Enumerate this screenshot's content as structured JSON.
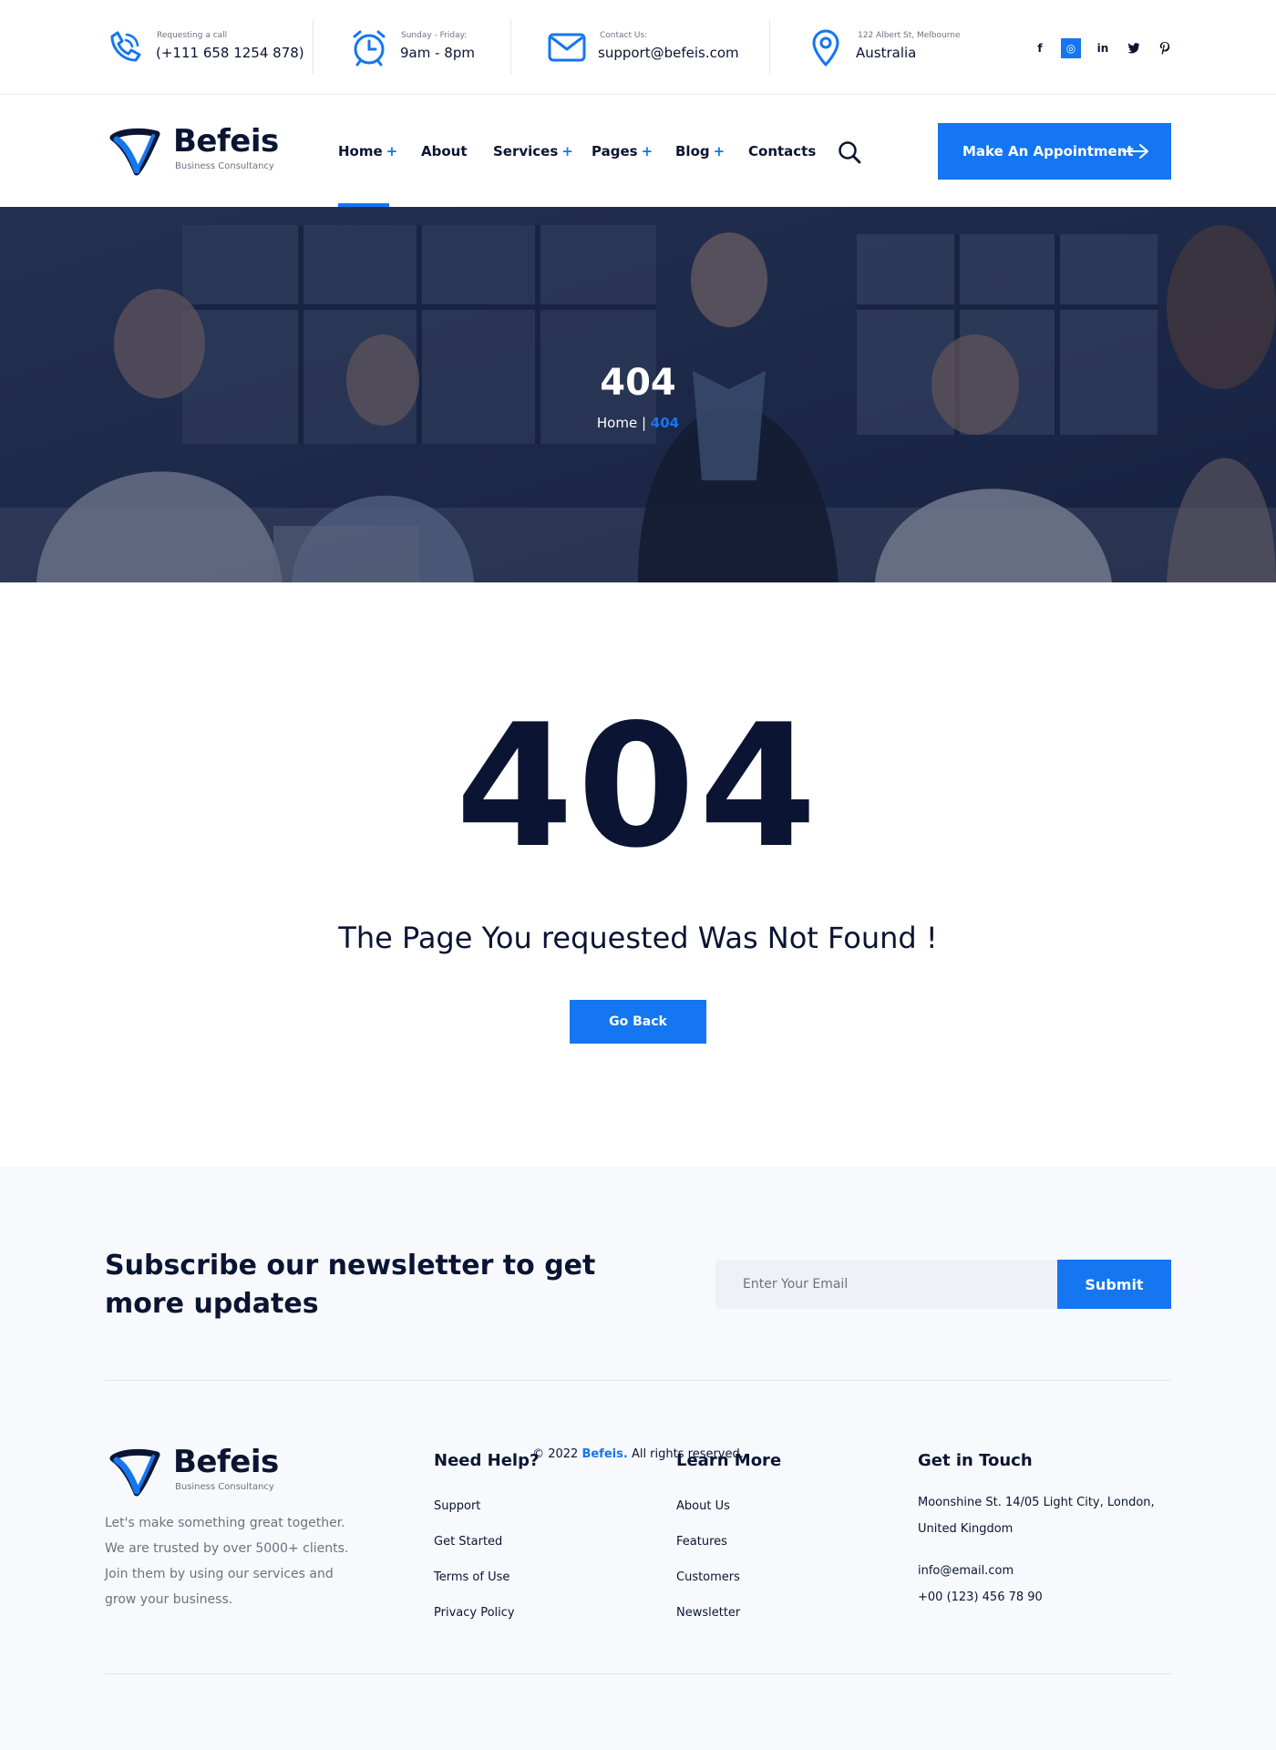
{
  "topbar": {
    "call": {
      "label": "Requesting a call",
      "value": "(+111 658 1254 878)",
      "icon": "phone-icon"
    },
    "hours": {
      "label": "Sunday - Friday:",
      "value": "9am - 8pm",
      "icon": "alarm-clock-icon"
    },
    "email": {
      "label": "Contact Us:",
      "value": "support@befeis.com",
      "icon": "envelope-icon"
    },
    "location": {
      "label": "122 Albert St, Melbourne",
      "value": "Australia",
      "icon": "map-pin-icon"
    },
    "socials": [
      {
        "name": "facebook-icon",
        "glyph": "f"
      },
      {
        "name": "dribbble-icon",
        "glyph": "◎"
      },
      {
        "name": "linkedin-icon",
        "glyph": "in"
      },
      {
        "name": "twitter-icon",
        "glyph": "🐦"
      },
      {
        "name": "pinterest-icon",
        "glyph": "P"
      }
    ]
  },
  "brand": {
    "name": "Befeis",
    "tagline": "Business Consultancy",
    "accent": "#1476f1",
    "dark": "#0b1533"
  },
  "nav": {
    "items": [
      {
        "label": "Home",
        "plus": "+"
      },
      {
        "label": "About",
        "plus": ""
      },
      {
        "label": "Services",
        "plus": "+"
      },
      {
        "label": "Pages",
        "plus": "+"
      },
      {
        "label": "Blog",
        "plus": "+"
      },
      {
        "label": "Contacts",
        "plus": ""
      }
    ],
    "active": "Home",
    "cta": "Make An Appointment"
  },
  "hero": {
    "title": "404",
    "breadcrumb_home": "Home",
    "breadcrumb_sep": "|",
    "breadcrumb_current": "404"
  },
  "error": {
    "code": "404",
    "message": "The Page You requested Was Not Found !",
    "button": "Go Back"
  },
  "newsletter": {
    "title": "Subscribe our newsletter to get more updates",
    "placeholder": "Enter Your Email",
    "button": "Submit"
  },
  "footer": {
    "about": "Let's make something great together. We are trusted by over 5000+ clients. Join them by using our services and grow your business.",
    "help": {
      "title": "Need Help?",
      "links": [
        "Support",
        "Get Started",
        "Terms of Use",
        "Privacy Policy"
      ]
    },
    "learn": {
      "title": "Learn More",
      "links": [
        "About Us",
        "Features",
        "Customers",
        "Newsletter"
      ]
    },
    "contact": {
      "title": "Get in Touch",
      "address_line1": "Moonshine St. 14/05 Light City, London,",
      "address_line2": "United Kingdom",
      "email": "info@email.com",
      "phone": "+00 (123) 456 78 90"
    },
    "copyright_pre": "© 2022",
    "copyright_brand": "Befeis.",
    "copyright_post": "All rights reserved."
  }
}
